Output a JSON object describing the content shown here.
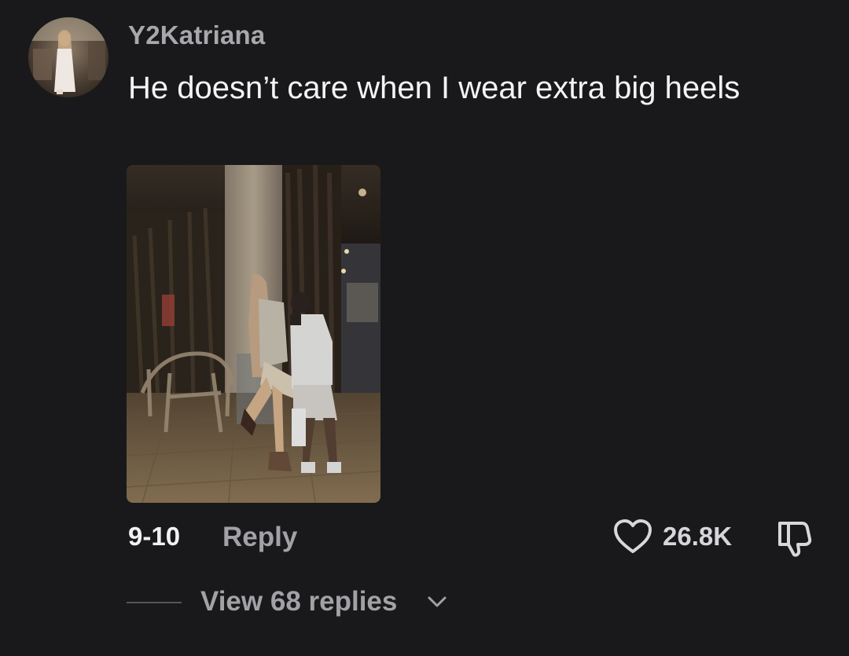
{
  "comment": {
    "username": "Y2Katriana",
    "text": "He doesn’t care when I wear extra big heels",
    "date": "9-10",
    "reply_label": "Reply",
    "like_count": "26.8K",
    "view_replies_label": "View 68 replies"
  },
  "icons": {
    "like": "heart-outline-icon",
    "dislike": "thumbs-down-outline-icon",
    "expand": "chevron-down-icon"
  },
  "colors": {
    "background": "#19191b",
    "username": "#a8a8ac",
    "text": "#f4f4f6",
    "secondary": "#a2a2a6"
  }
}
